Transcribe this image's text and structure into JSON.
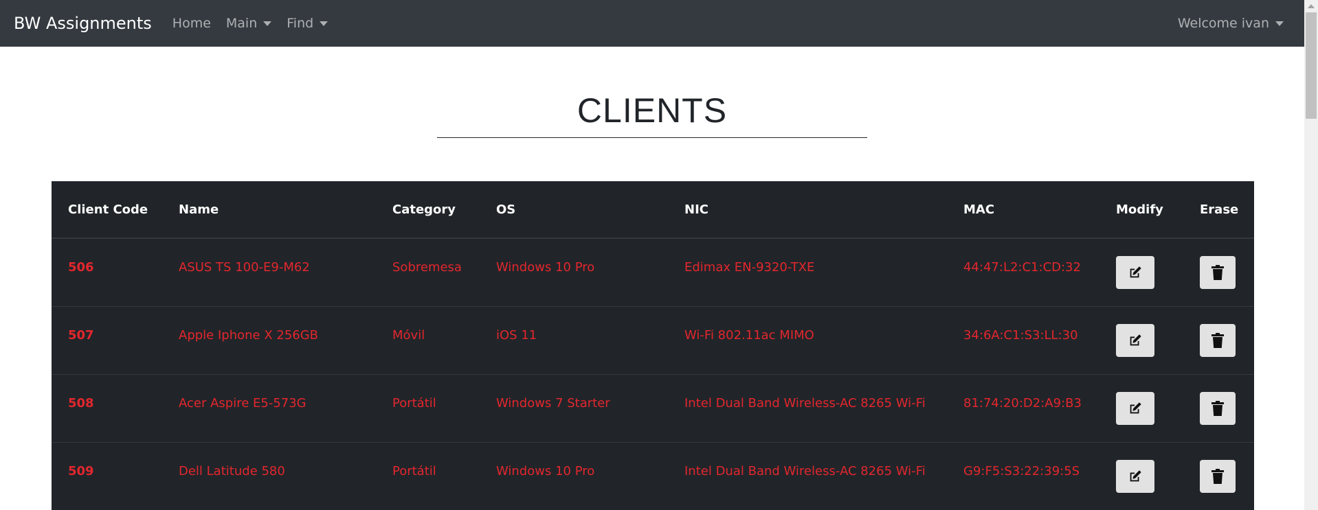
{
  "navbar": {
    "brand": "BW Assignments",
    "items": [
      {
        "label": "Home",
        "dropdown": false
      },
      {
        "label": "Main",
        "dropdown": true
      },
      {
        "label": "Find",
        "dropdown": true
      }
    ],
    "user_menu": "Welcome ivan"
  },
  "page": {
    "title": "CLIENTS"
  },
  "table": {
    "headers": [
      "Client Code",
      "Name",
      "Category",
      "OS",
      "NIC",
      "MAC",
      "Modify",
      "Erase"
    ],
    "rows": [
      {
        "code": "506",
        "name": "ASUS TS 100-E9-M62",
        "category": "Sobremesa",
        "os": "Windows 10 Pro",
        "nic": "Edimax EN-9320-TXE",
        "mac": "44:47:L2:C1:CD:32"
      },
      {
        "code": "507",
        "name": "Apple Iphone X 256GB",
        "category": "Móvil",
        "os": "iOS 11",
        "nic": "Wi-Fi 802.11ac MIMO",
        "mac": "34:6A:C1:S3:LL:30"
      },
      {
        "code": "508",
        "name": "Acer Aspire E5-573G",
        "category": "Portátil",
        "os": "Windows 7 Starter",
        "nic": "Intel Dual Band Wireless-AC 8265 Wi-Fi",
        "mac": "81:74:20:D2:A9:B3"
      },
      {
        "code": "509",
        "name": "Dell Latitude 580",
        "category": "Portátil",
        "os": "Windows 10 Pro",
        "nic": "Intel Dual Band Wireless-AC 8265 Wi-Fi",
        "mac": "G9:F5:S3:22:39:5S"
      }
    ],
    "row_actions": {
      "modify_icon": "edit-icon",
      "erase_icon": "trash-icon"
    }
  },
  "colors": {
    "navbar_bg": "#343a40",
    "table_bg": "#212529",
    "cell_text": "#e3262e",
    "button_bg": "#e2e2e2"
  }
}
